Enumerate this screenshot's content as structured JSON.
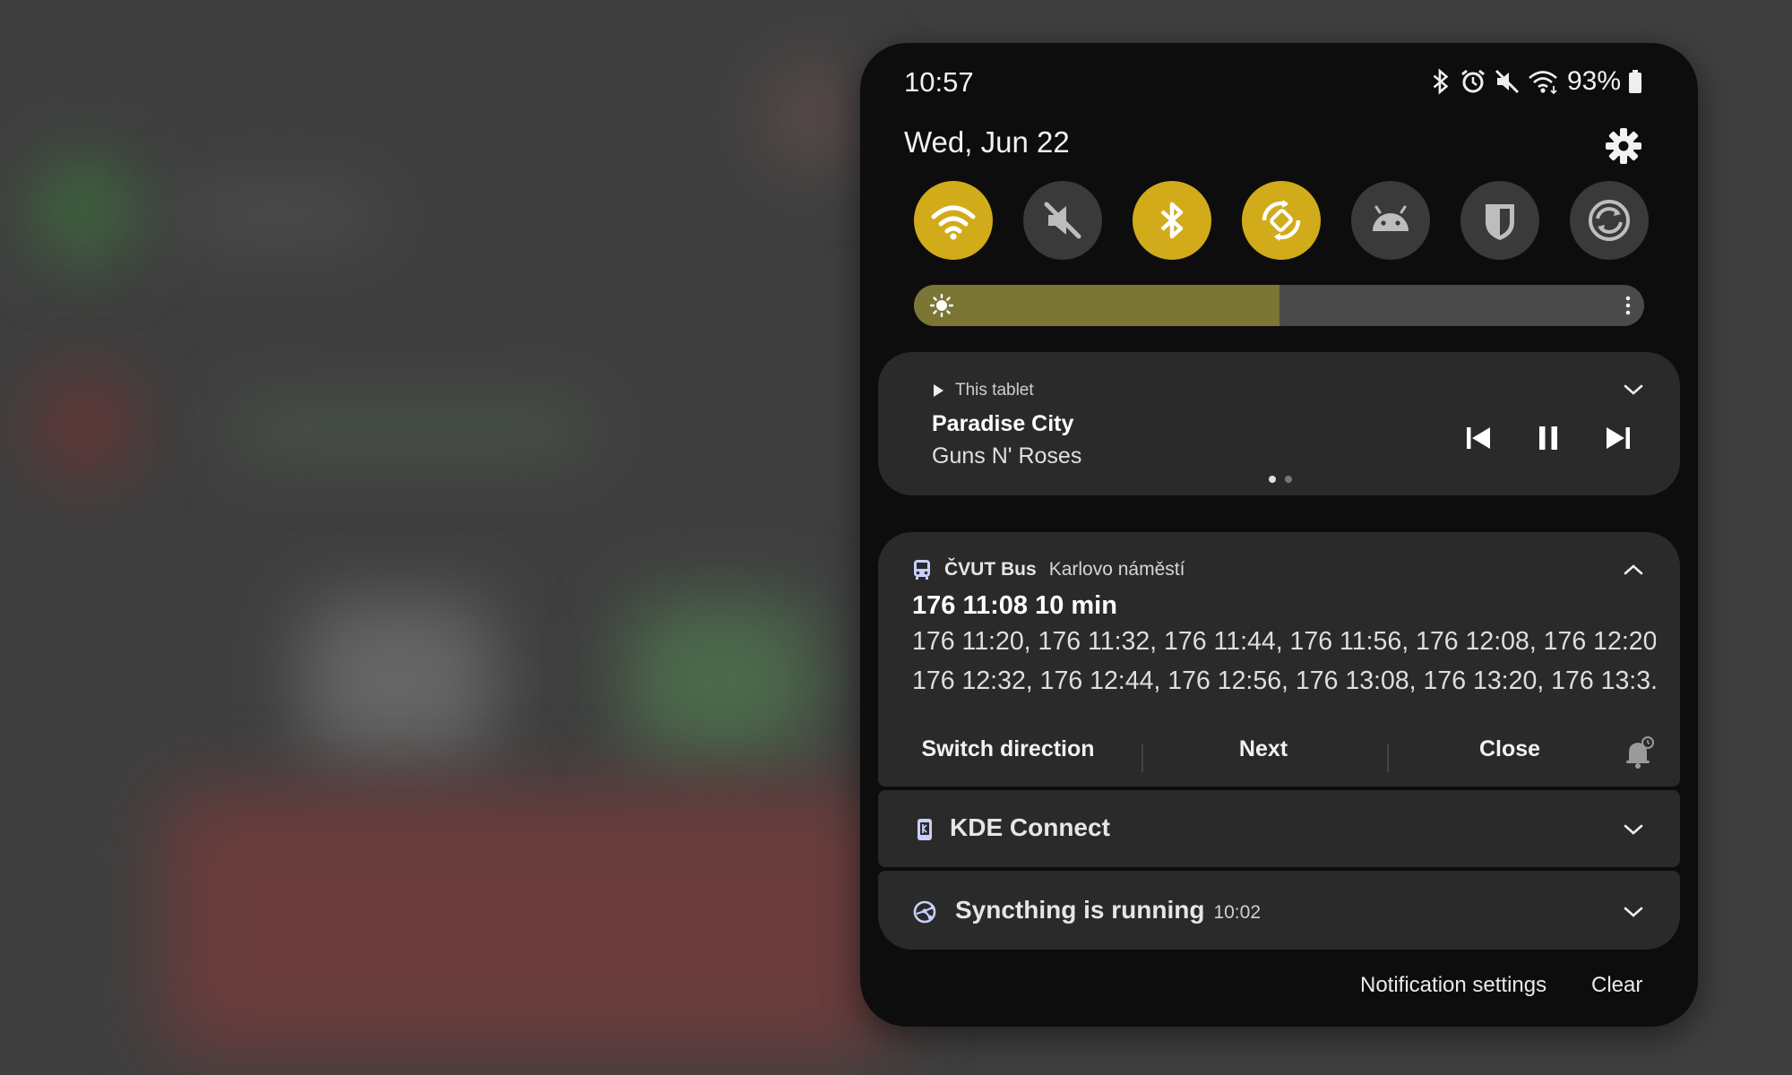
{
  "status_bar": {
    "time": "10:57",
    "battery": "93%"
  },
  "header": {
    "date": "Wed, Jun 22"
  },
  "quick_toggles": [
    {
      "id": "wifi",
      "icon": "wifi-icon",
      "on": true
    },
    {
      "id": "sound",
      "icon": "mute-icon",
      "on": false
    },
    {
      "id": "bluetooth",
      "icon": "bluetooth-icon",
      "on": true
    },
    {
      "id": "rotate",
      "icon": "auto-rotate-icon",
      "on": true
    },
    {
      "id": "android",
      "icon": "android-icon",
      "on": false
    },
    {
      "id": "bitwarden",
      "icon": "shield-icon",
      "on": false
    },
    {
      "id": "sync",
      "icon": "sync-icon",
      "on": false
    }
  ],
  "brightness": {
    "level": 0.5
  },
  "media": {
    "source": "This tablet",
    "title": "Paradise City",
    "artist": "Guns N' Roses",
    "page_count": 2,
    "active_page": 0
  },
  "bus_notification": {
    "app": "ČVUT Bus",
    "subtitle": "Karlovo náměstí",
    "title": "176 11:08 10 min",
    "line1": "176 11:20, 176 11:32, 176 11:44, 176 11:56, 176 12:08, 176 12:20,",
    "line2": "176 12:32, 176 12:44, 176 12:56, 176 13:08, 176 13:20, 176 13:3...",
    "actions": {
      "switch": "Switch direction",
      "next": "Next",
      "close": "Close"
    }
  },
  "kde_notification": {
    "app": "KDE Connect"
  },
  "sync_notification": {
    "title": "Syncthing is running",
    "time": "10:02"
  },
  "footer": {
    "settings": "Notification settings",
    "clear": "Clear"
  },
  "colors": {
    "accent": "#d1ab1a",
    "brightness_fill": "#7b7536",
    "panel": "#0d0d0d",
    "card": "#2a2a2a"
  }
}
